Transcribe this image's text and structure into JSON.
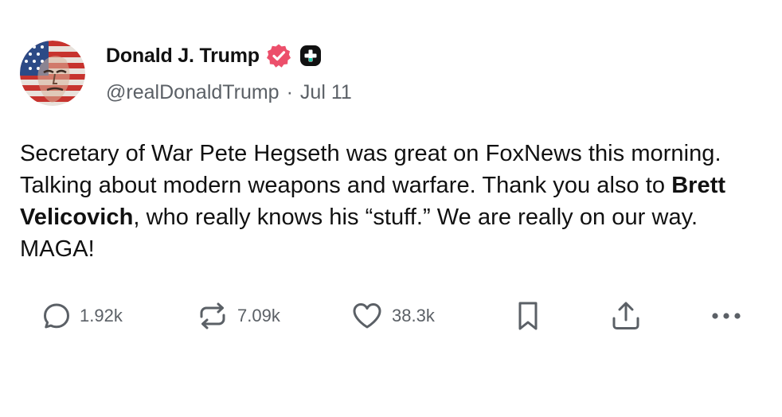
{
  "post": {
    "author": {
      "display_name": "Donald J. Trump",
      "handle": "@realDonaldTrump",
      "verified_icon": "verified-badge-icon",
      "plus_icon": "truth-plus-icon"
    },
    "separator": "·",
    "date": "Jul 11",
    "body": {
      "part1": "Secretary of War Pete Hegseth was great on FoxNews this morning. Talking about modern weapons and warfare. Thank you also to ",
      "bold": "Brett Velicovich",
      "part2": ", who really knows his “stuff.” We are really on our way. MAGA!"
    },
    "actions": {
      "replies": "1.92k",
      "retruths": "7.09k",
      "likes": "38.3k"
    }
  },
  "colors": {
    "badge": "#ec4f6b",
    "text": "#111111",
    "muted": "#5b6066",
    "icon": "#5b6066"
  }
}
